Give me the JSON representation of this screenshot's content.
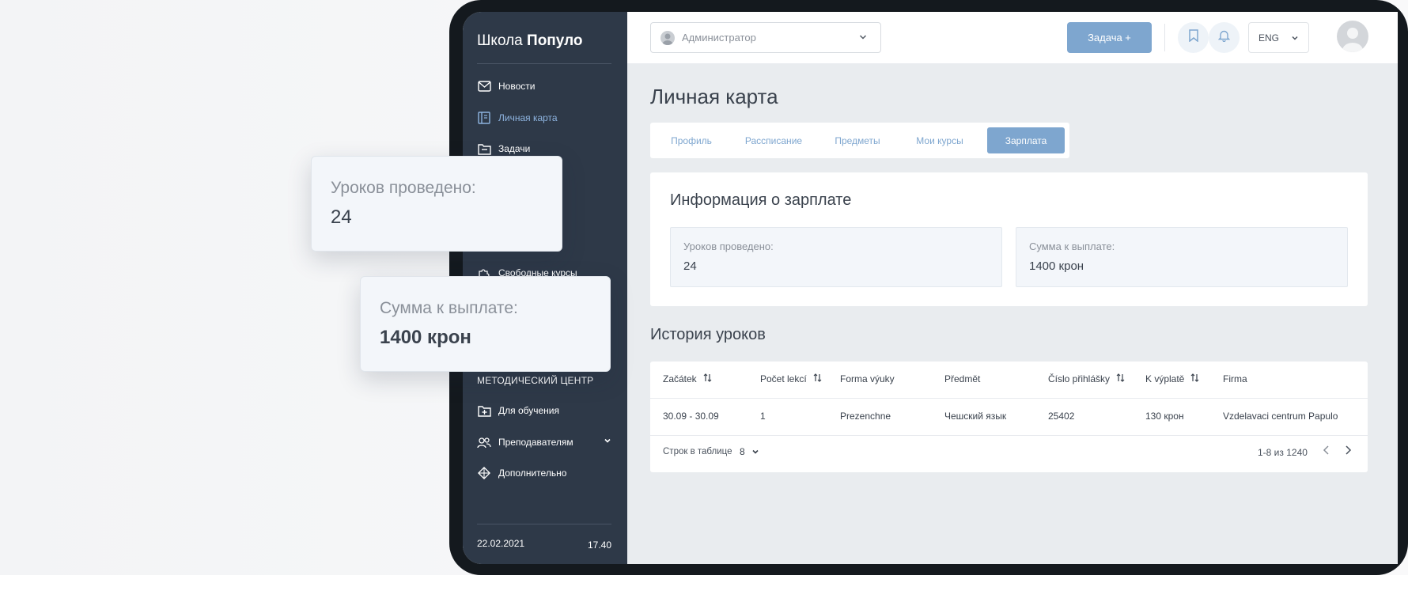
{
  "sidebar": {
    "logo_regular": "Школа",
    "logo_bold": "Популо",
    "items": [
      {
        "label": "Новости",
        "icon": "mail-icon"
      },
      {
        "label": "Личная карта",
        "icon": "id-card-icon"
      },
      {
        "label": "Задачи",
        "icon": "folder-icon"
      },
      {
        "label": "Свободные курсы",
        "icon": "puzzle-icon"
      }
    ],
    "section_label": "МЕТОДИЧЕСКИЙ ЦЕНТР",
    "section_items": [
      {
        "label": "Для обучения",
        "icon": "folder-plus-icon"
      },
      {
        "label": "Преподавателям",
        "icon": "users-icon"
      },
      {
        "label": "Дополнительно",
        "icon": "diamond-icon"
      }
    ],
    "date": "22.02.2021",
    "time": "17.40"
  },
  "topbar": {
    "role": "Администратор",
    "task_button": "Задача +",
    "language": "ENG"
  },
  "page": {
    "title": "Личная карта",
    "tabs": [
      "Профиль",
      "Рассписание",
      "Предметы",
      "Мои курсы",
      "Зарплата"
    ],
    "active_tab": "Зарплата"
  },
  "salary": {
    "title": "Информация о зарплате",
    "lessons_label": "Уроков проведено:",
    "lessons_value": "24",
    "amount_label": "Сумма к выплате:",
    "amount_value": "1400 крон"
  },
  "history": {
    "title": "История уроков",
    "columns": [
      "Začátek",
      "Počet lekcí",
      "Forma výuky",
      "Předmět",
      "Číslo přihlášky",
      "K výplatě",
      "Firma"
    ],
    "rows": [
      [
        "30.09 - 30.09",
        "1",
        "Prezenchne",
        "Чешский язык",
        "25402",
        "130 крон",
        "Vzdelavaci centrum Papulo"
      ]
    ],
    "rows_per_page_label": "Строк в таблице",
    "rows_per_page": "8",
    "pagination": "1-8 из 1240"
  },
  "floating": {
    "lessons_label": "Уроков проведено:",
    "lessons_value": "24",
    "amount_label": "Сумма к выплате:",
    "amount_value": "1400 крон"
  },
  "colors": {
    "sidebar_bg": "#2e3948",
    "accent": "#7ea6cf",
    "content_bg": "#e9ecef"
  }
}
